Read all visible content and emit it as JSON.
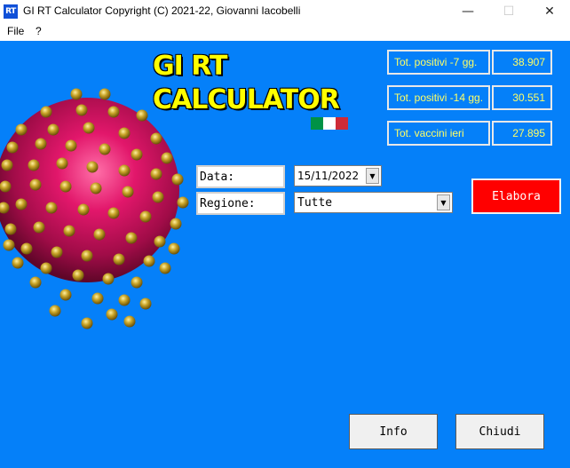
{
  "window": {
    "icon_text": "RT",
    "title": "GI RT Calculator Copyright (C) 2021-22, Giovanni Iacobelli",
    "minimize_glyph": "—",
    "maximize_glyph": "☐",
    "close_glyph": "✕"
  },
  "menu": [
    "File",
    "?"
  ],
  "logo": {
    "line1": "GI RT",
    "line2": "CALCULATOR"
  },
  "flag_colors": [
    "#009246",
    "#ffffff",
    "#ce2b37"
  ],
  "stats": [
    {
      "label": "Tot. positivi -7 gg.",
      "value": "38.907"
    },
    {
      "label": "Tot. positivi -14 gg.",
      "value": "30.551"
    },
    {
      "label": "Tot. vaccini ieri",
      "value": "27.895"
    }
  ],
  "form": {
    "date_label": "Data:",
    "date_value": "15/11/2022",
    "region_label": "Regione:",
    "region_value": "Tutte"
  },
  "buttons": {
    "elabora": "Elabora",
    "info": "Info",
    "close": "Chiudi"
  },
  "colors": {
    "background": "#0580f9",
    "stat_text": "#ffff66",
    "logo_text": "#ffff00",
    "elabora_bg": "#ff0000"
  }
}
